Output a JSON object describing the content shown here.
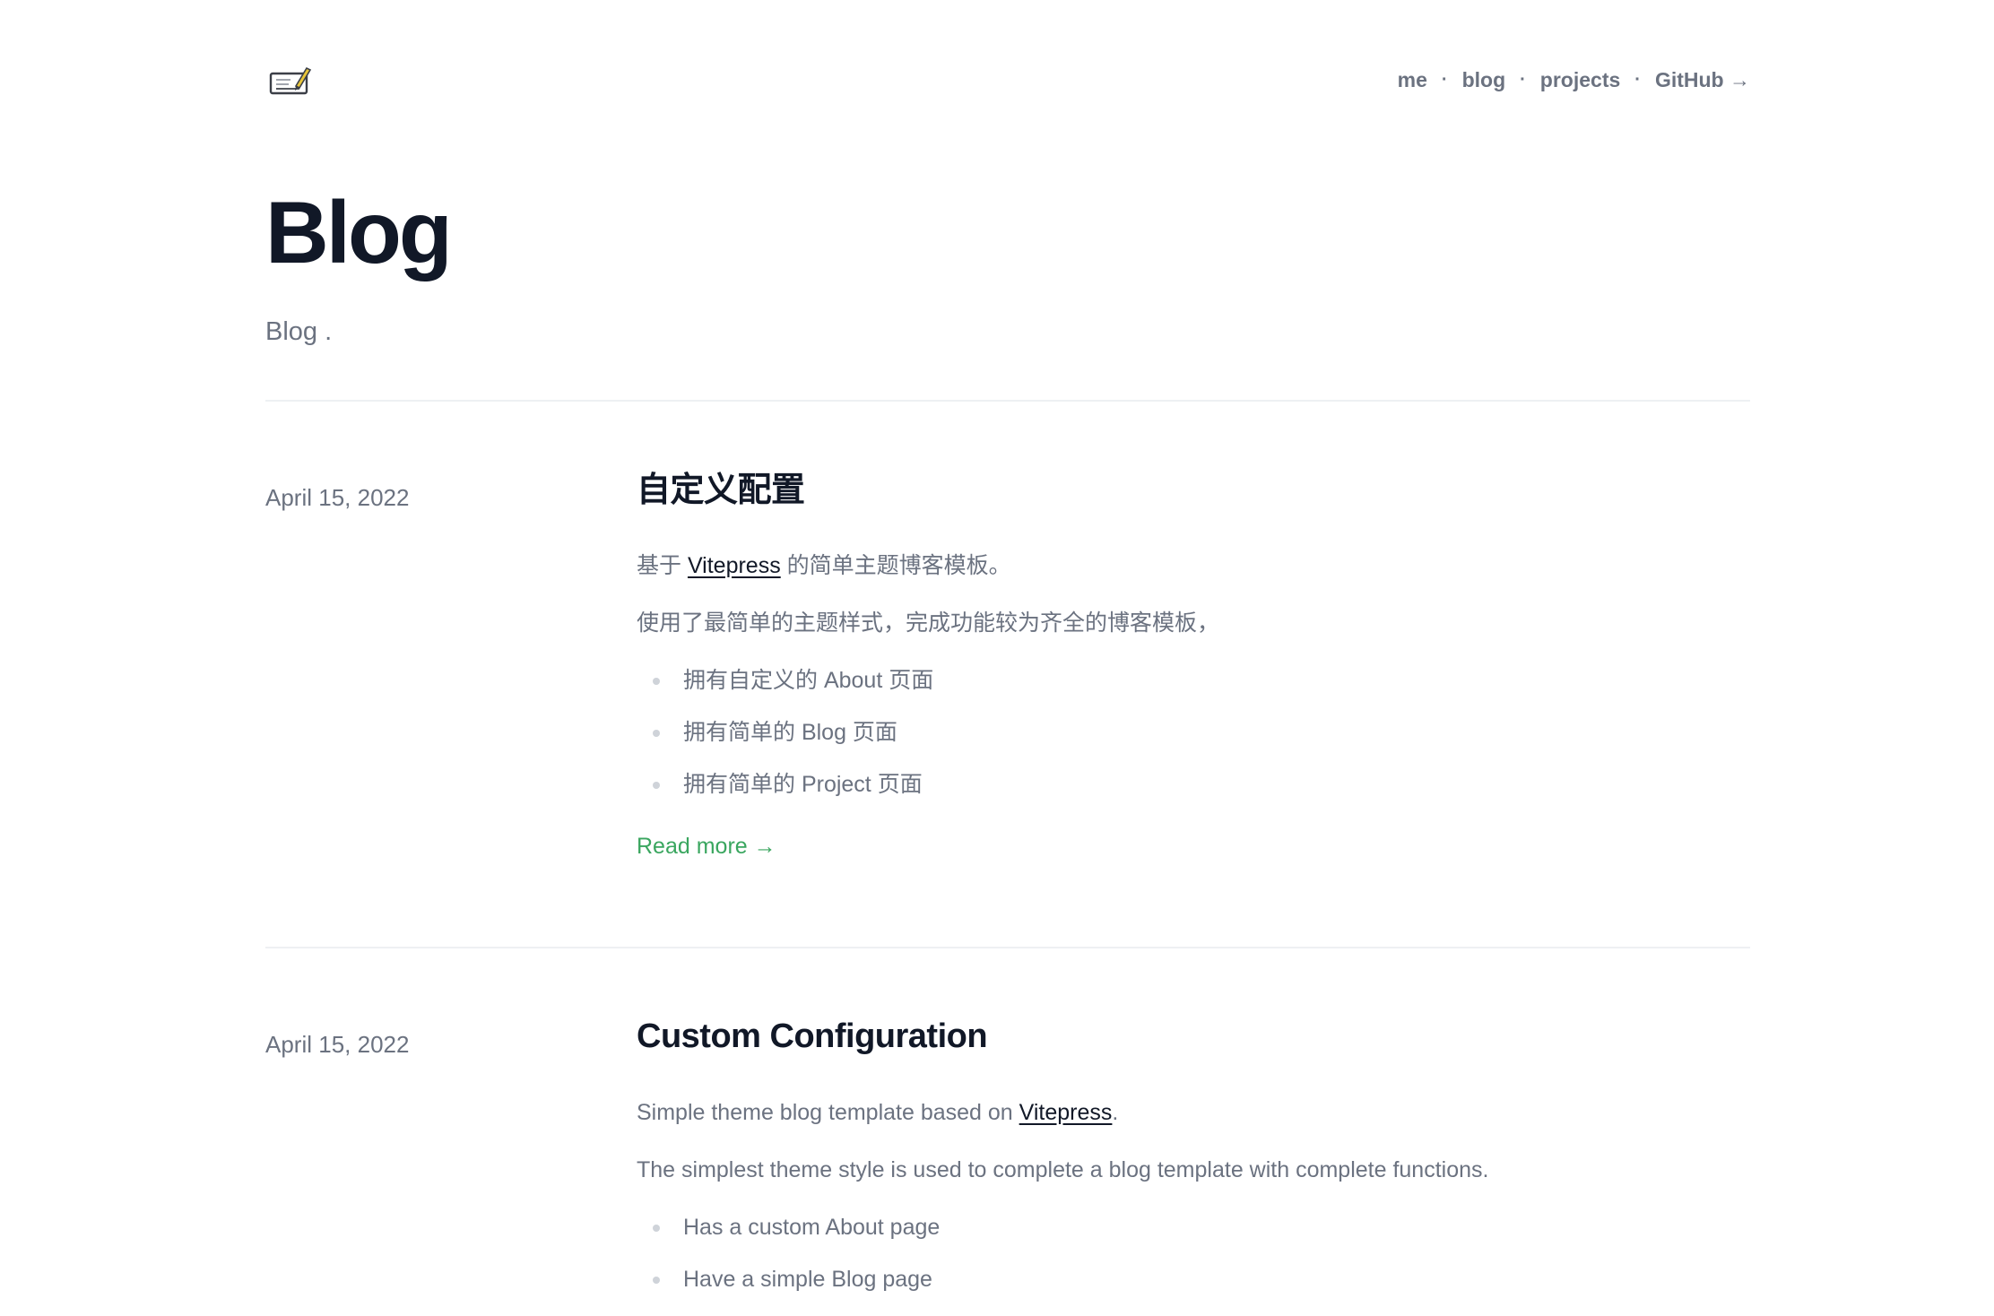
{
  "nav": {
    "items": [
      {
        "label": "me"
      },
      {
        "label": "blog"
      },
      {
        "label": "projects"
      },
      {
        "label": "GitHub →"
      }
    ],
    "separator": "·"
  },
  "page": {
    "title": "Blog",
    "subtitle": "Blog ."
  },
  "posts": [
    {
      "date": "April 15, 2022",
      "title": "自定义配置",
      "intro_before": "基于 ",
      "intro_link": "Vitepress",
      "intro_after": " 的简单主题博客模板。",
      "description": "使用了最简单的主题样式，完成功能较为齐全的博客模板，",
      "features": [
        "拥有自定义的 About 页面",
        "拥有简单的 Blog 页面",
        "拥有简单的 Project 页面"
      ],
      "read_more": "Read more →"
    },
    {
      "date": "April 15, 2022",
      "title": "Custom Configuration",
      "intro_before": "Simple theme blog template based on ",
      "intro_link": "Vitepress",
      "intro_after": ".",
      "description": "The simplest theme style is used to complete a blog template with complete functions.",
      "features": [
        "Has a custom About page",
        "Have a simple Blog page"
      ]
    }
  ],
  "colors": {
    "heading": "#111827",
    "text": "#6b7280",
    "accent": "#3aa65f",
    "divider": "#eef0f3"
  },
  "icons": {
    "logo": "pen-on-paper-icon"
  }
}
